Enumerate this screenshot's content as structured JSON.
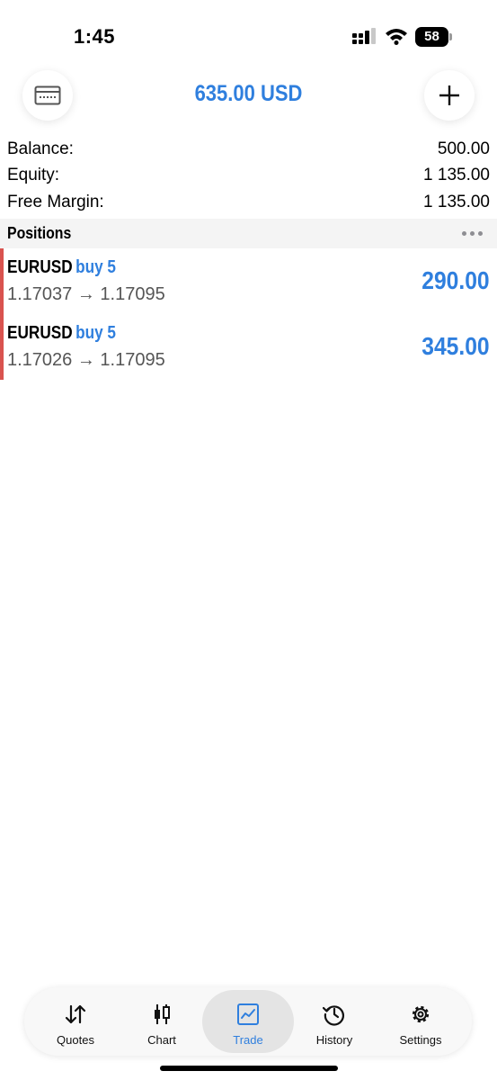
{
  "status_bar": {
    "time": "1:45",
    "battery": "58"
  },
  "header": {
    "title": "635.00 USD",
    "left_icon": "card-icon",
    "right_icon": "plus-icon"
  },
  "summary": [
    {
      "label": "Balance:",
      "value": "500.00"
    },
    {
      "label": "Equity:",
      "value": "1 135.00"
    },
    {
      "label": "Free Margin:",
      "value": "1 135.00"
    }
  ],
  "positions_section": {
    "title": "Positions"
  },
  "positions": [
    {
      "symbol": "EURUSD",
      "type": "buy 5",
      "prices": "1.17037 → 1.17095",
      "profit": "290.00"
    },
    {
      "symbol": "EURUSD",
      "type": "buy 5",
      "prices": "1.17026 → 1.17095",
      "profit": "345.00"
    }
  ],
  "tabs": [
    {
      "label": "Quotes",
      "icon": "quotes-arrows-icon"
    },
    {
      "label": "Chart",
      "icon": "candlestick-icon"
    },
    {
      "label": "Trade",
      "icon": "trade-chart-icon",
      "active": true
    },
    {
      "label": "History",
      "icon": "history-icon"
    },
    {
      "label": "Settings",
      "icon": "gear-icon"
    }
  ],
  "colors": {
    "accent": "#2f7fde",
    "loss_marker": "#d9534f"
  }
}
